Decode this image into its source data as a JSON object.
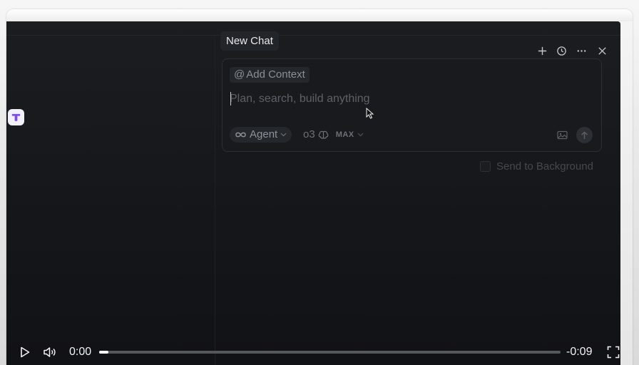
{
  "chat": {
    "title": "New Chat",
    "add_context_label": "Add Context",
    "add_context_prefix": "@",
    "prompt_placeholder": "Plan, search, build anything",
    "prompt_value": "",
    "mode_label": "Agent",
    "model_label": "o3",
    "max_badge": "MAX",
    "send_to_background_label": "Send to Background",
    "send_to_background_checked": false
  },
  "header_icons": [
    "plus-icon",
    "history-icon",
    "more-icon",
    "close-icon"
  ],
  "video": {
    "elapsed": "0:00",
    "remaining": "-0:09",
    "progress": 0.02,
    "icons": [
      "play-icon",
      "volume-icon",
      "fullscreen-icon"
    ]
  },
  "colors": {
    "app_bg": "#141619",
    "panel_bg": "#181a1e",
    "text_primary": "#e9e9eb",
    "text_muted": "#5d6066",
    "extension_accent": "#7b4fe0"
  }
}
